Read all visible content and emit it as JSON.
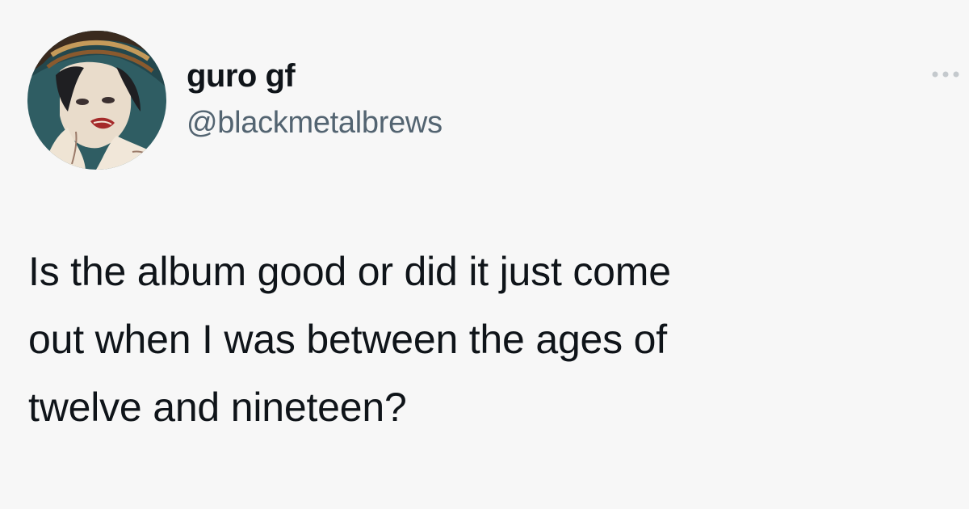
{
  "user": {
    "display_name": "guro gf",
    "handle": "@blackmetalbrews",
    "avatar_icon": "illustrated-portrait-avatar"
  },
  "menu": {
    "icon": "more-dots-icon"
  },
  "tweet": {
    "text": "Is the album good or did it just come\nout when I was between the ages of\ntwelve and nineteen?"
  },
  "colors": {
    "background": "#f7f7f7",
    "text_primary": "#0f1419",
    "text_secondary": "#536471",
    "menu_dots": "#c4c9cd"
  }
}
